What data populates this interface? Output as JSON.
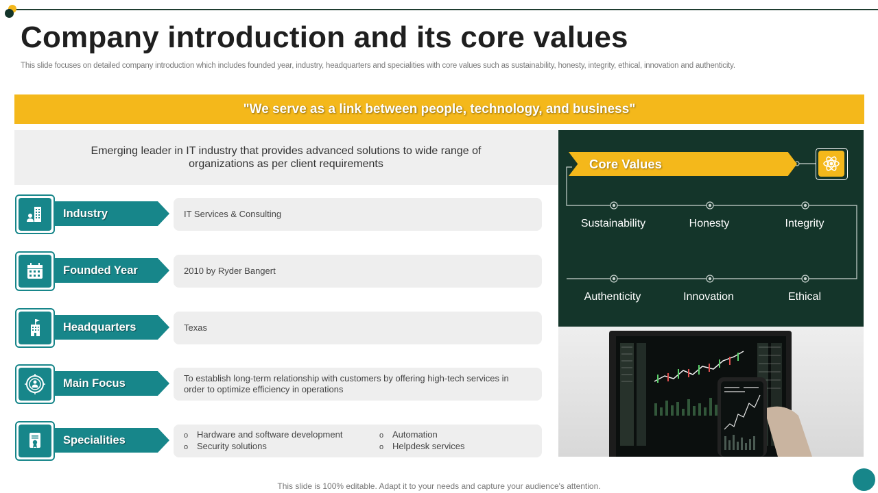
{
  "header": {
    "title": "Company introduction and its core values",
    "subtitle": "This slide focuses on detailed company introduction which includes founded year, industry, headquarters and specialities with core values such as sustainability, honesty, integrity, ethical, innovation and authenticity."
  },
  "banner": {
    "quote": "\"We serve as a link between people, technology, and business\""
  },
  "intro": {
    "text": "Emerging leader in IT industry that provides advanced solutions to wide range of organizations as per client requirements"
  },
  "details": [
    {
      "label": "Industry",
      "value": "IT Services & Consulting",
      "icon": "building-person-icon"
    },
    {
      "label": "Founded Year",
      "value": "2010 by Ryder Bangert",
      "icon": "calendar-icon"
    },
    {
      "label": "Headquarters",
      "value": "Texas",
      "icon": "office-flag-icon"
    },
    {
      "label": "Main Focus",
      "value": "To establish long-term relationship with customers by offering high-tech services in order to optimize efficiency in operations",
      "icon": "target-person-icon"
    }
  ],
  "specialities": {
    "label": "Specialities",
    "icon": "certificate-icon",
    "items": [
      "Hardware and software development",
      "Automation",
      "Security solutions",
      "Helpdesk services"
    ],
    "bullet": "o"
  },
  "core_values": {
    "title": "Core Values",
    "icon": "atom-network-icon",
    "values": [
      "Sustainability",
      "Honesty",
      "Integrity",
      "Authenticity",
      "Innovation",
      "Ethical"
    ]
  },
  "photo": {
    "icon": "laptop-smartphone-stock-chart-image"
  },
  "footer": {
    "text": "This slide is 100% editable. Adapt it to your needs and capture your audience's attention."
  },
  "colors": {
    "teal": "#17868a",
    "yellow": "#f4b81b",
    "dark_green": "#14352a"
  }
}
